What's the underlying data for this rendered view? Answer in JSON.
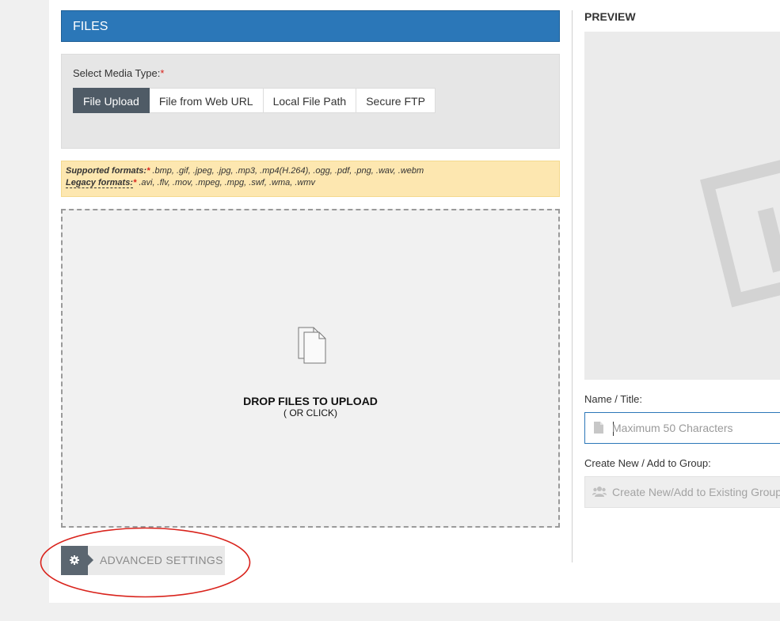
{
  "files_panel": {
    "header": "FILES",
    "media_type": {
      "label": "Select Media Type:",
      "required_mark": "*",
      "options": [
        {
          "label": "File Upload",
          "active": true
        },
        {
          "label": "File from Web URL",
          "active": false
        },
        {
          "label": "Local File Path",
          "active": false
        },
        {
          "label": "Secure FTP",
          "active": false
        }
      ]
    },
    "formats": {
      "supported_label": "Supported formats:",
      "supported_list": " .bmp, .gif, .jpeg, .jpg, .mp3, .mp4(H.264), .ogg, .pdf, .png, .wav, .webm",
      "legacy_label": "Legacy formats:",
      "legacy_list": " .avi, .flv, .mov, .mpeg, .mpg, .swf, .wma, .wmv",
      "required_mark": "*"
    },
    "dropzone": {
      "title": "DROP FILES TO UPLOAD",
      "subtitle": "( OR CLICK)",
      "icon": "files-icon"
    },
    "advanced_settings": {
      "label": "ADVANCED SETTINGS",
      "icon": "gear-icon"
    }
  },
  "preview_panel": {
    "title": "PREVIEW",
    "name_field": {
      "label": "Name / Title:",
      "placeholder": "Maximum 50 Characters",
      "value": "",
      "icon": "document-icon"
    },
    "group_field": {
      "label": "Create New / Add to Group:",
      "placeholder": "Create New/Add to Existing Group",
      "value": "",
      "icon": "users-icon"
    }
  },
  "colors": {
    "header_blue": "#2b77b8",
    "active_button": "#4f5b66",
    "formats_bg": "#fde7b0",
    "required_red": "#d9231c",
    "annotation_red": "#d9231c"
  }
}
